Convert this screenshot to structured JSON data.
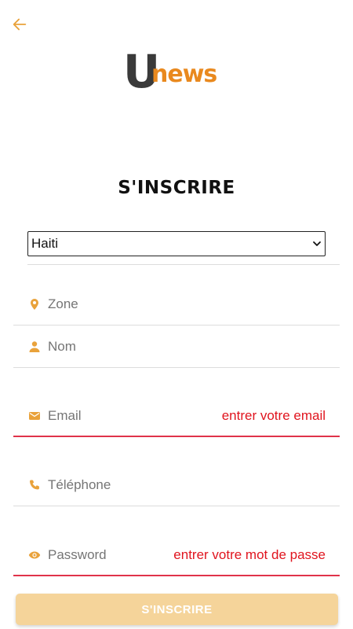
{
  "header": {
    "back_icon": "arrow-left-icon"
  },
  "logo": {
    "letter": "U",
    "word": "news",
    "colors": {
      "letter": "#3a3a3a",
      "word": "#e9891e"
    }
  },
  "title": "S'INSCRIRE",
  "country_select": {
    "value": "Haiti"
  },
  "fields": {
    "zone": {
      "icon": "location-pin-icon",
      "placeholder": "Zone",
      "error": ""
    },
    "nom": {
      "icon": "person-icon",
      "placeholder": "Nom",
      "error": ""
    },
    "email": {
      "icon": "envelope-icon",
      "placeholder": "Email",
      "error": "entrer votre email"
    },
    "telephone": {
      "icon": "phone-icon",
      "placeholder": "Téléphone",
      "error": ""
    },
    "password": {
      "icon": "eye-icon",
      "placeholder": "Password",
      "error": "entrer votre mot de passe"
    }
  },
  "submit": {
    "label": "S'INSCRIRE"
  },
  "colors": {
    "accent": "#e9a23b",
    "error": "#e0141e",
    "button_bg": "#f5d49a"
  }
}
